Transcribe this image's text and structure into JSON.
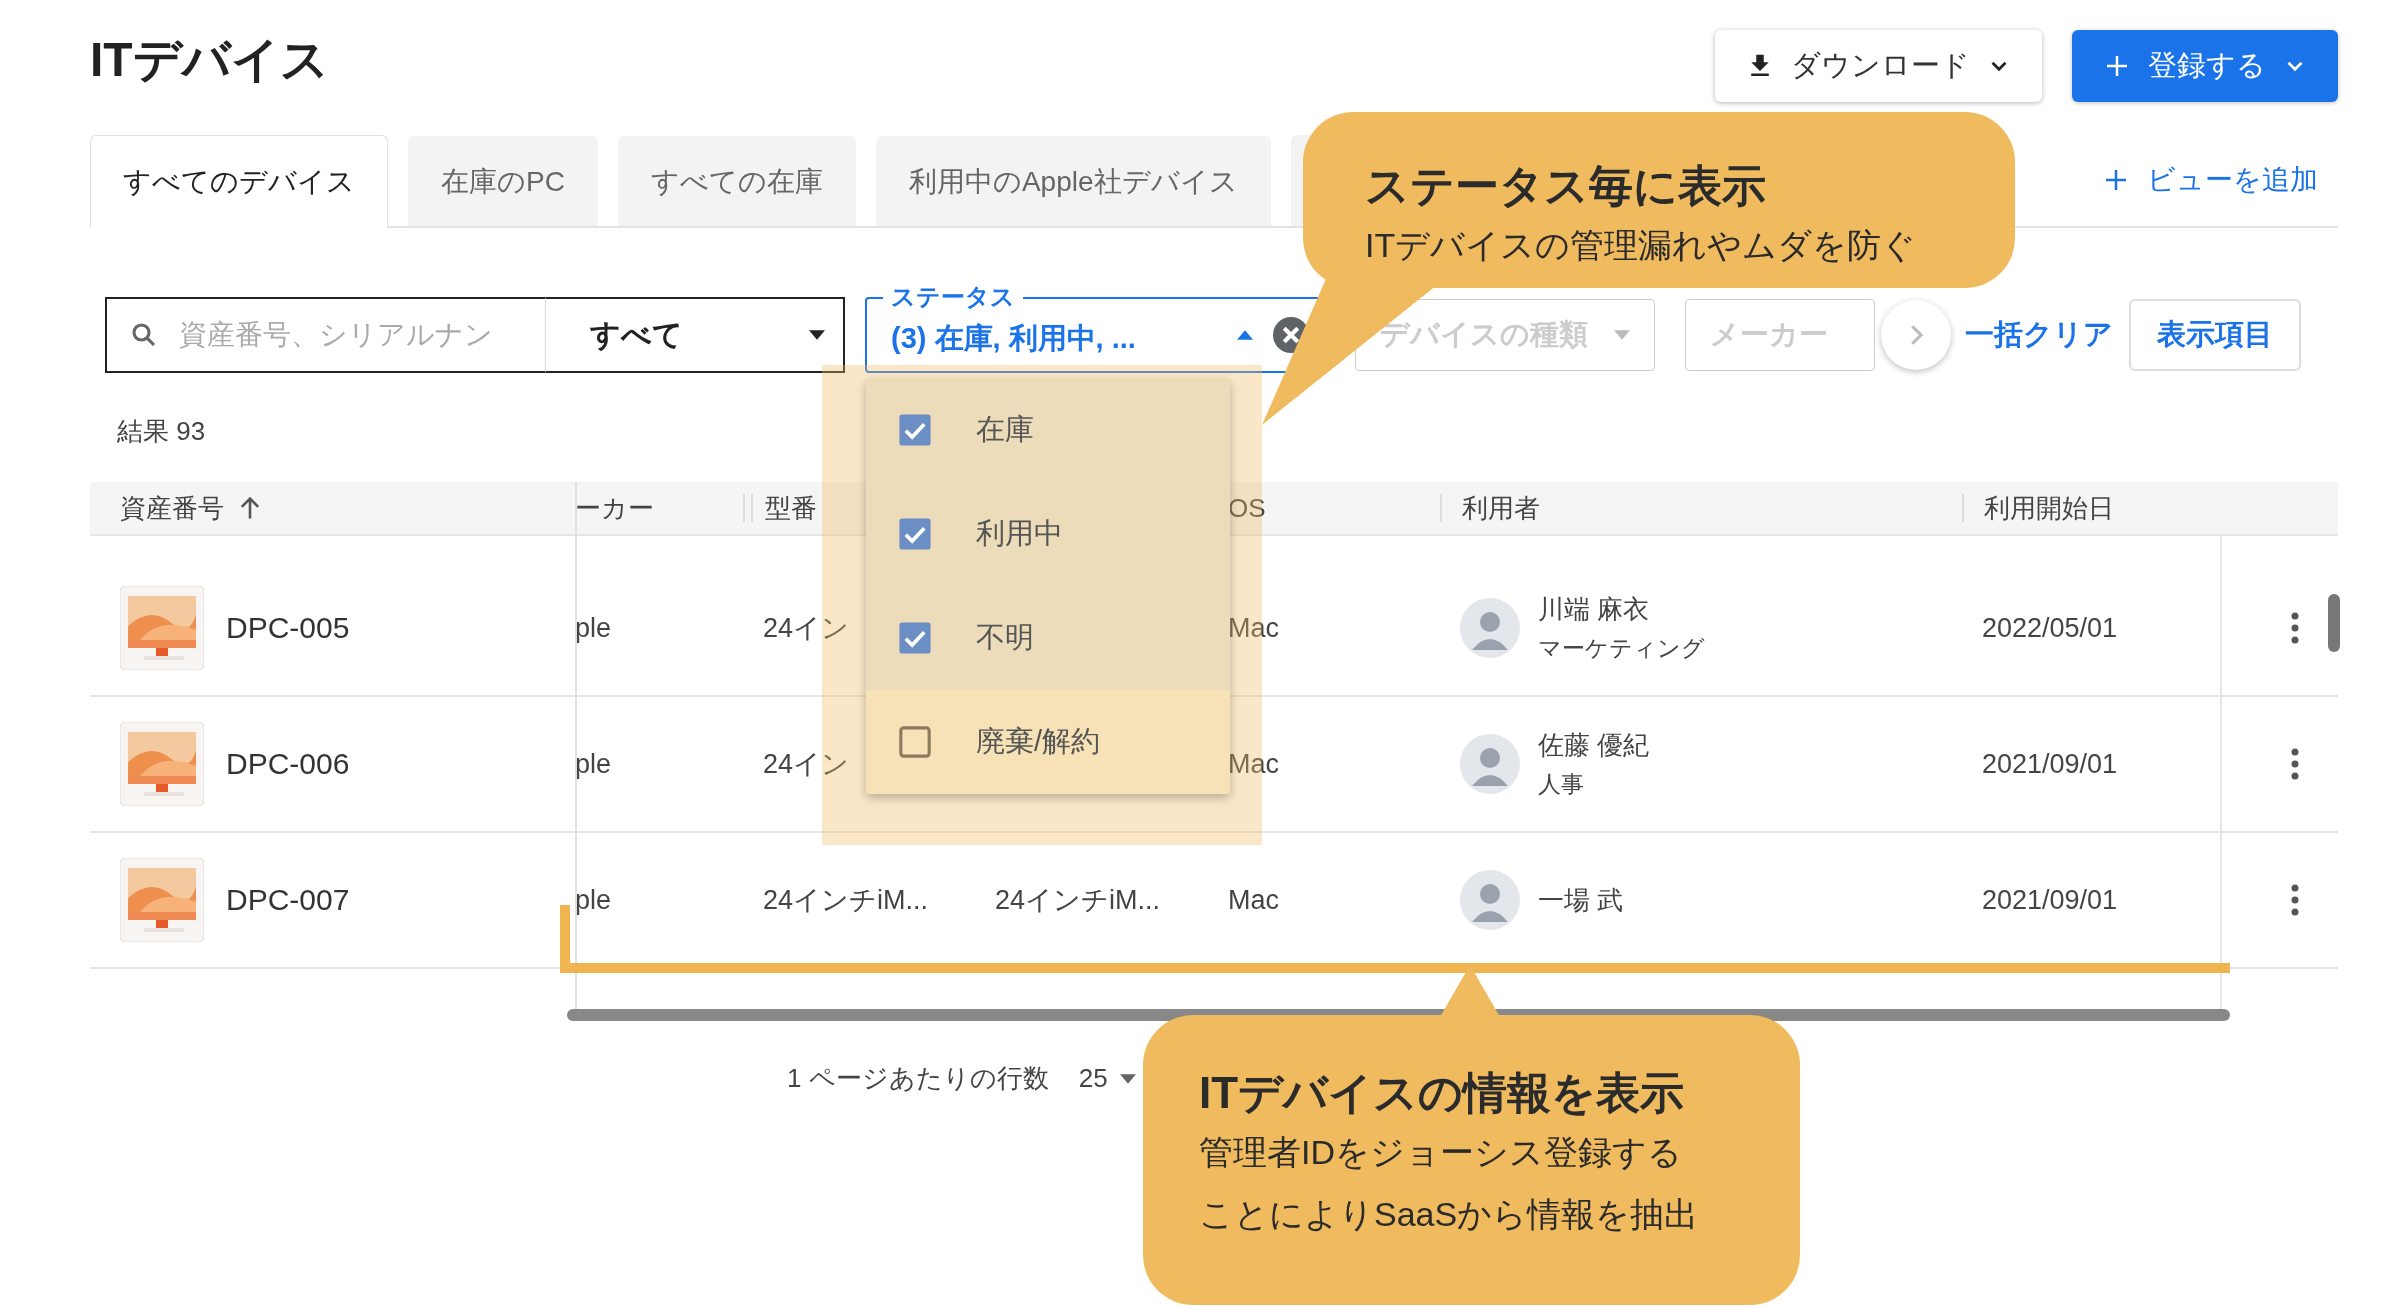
{
  "title": "ITデバイス",
  "actions": [
    {
      "label": "ダウンロード",
      "kind": "download"
    },
    {
      "label": "登録する",
      "kind": "register"
    }
  ],
  "tabs": [
    {
      "label": "すべてのデバイス",
      "selected": true
    },
    {
      "label": "在庫のPC",
      "selected": false
    },
    {
      "label": "すべての在庫",
      "selected": false
    },
    {
      "label": "利用中のApple社デバイス",
      "selected": false
    }
  ],
  "add_view": "ビューを追加",
  "filters": {
    "search": {
      "placeholder": "資産番号、シリアルナン"
    },
    "scope": "すべて",
    "status": {
      "label": "ステータス",
      "value": "(3) 在庫, 利用中, ...",
      "expanded": true,
      "options": [
        {
          "label": "在庫",
          "checked": true
        },
        {
          "label": "利用中",
          "checked": true
        },
        {
          "label": "不明",
          "checked": true
        },
        {
          "label": "廃棄/解約",
          "checked": false
        }
      ]
    },
    "device_type": "デバイスの種類",
    "maker": "メーカー",
    "clear_all": "一括クリア",
    "columns_button": "表示項目"
  },
  "result_count": "結果 93",
  "table": {
    "columns": [
      {
        "label": "資産番号",
        "sorted": true
      },
      {
        "label": "ーカー",
        "sorted": false
      },
      {
        "label": "型番",
        "sorted": false
      },
      {
        "label": "OS",
        "sorted": false
      },
      {
        "label": "利用者",
        "sorted": false
      },
      {
        "label": "利用開始日",
        "sorted": false
      }
    ],
    "rows": [
      {
        "asset_no": "DPC-005",
        "maker": "ple",
        "model": "24イン",
        "os": "Mac",
        "user": "川端 麻衣",
        "department": "マーケティング",
        "start_date": "2022/05/01"
      },
      {
        "asset_no": "DPC-006",
        "maker": "ple",
        "model": "24イン",
        "os": "Mac",
        "user": "佐藤 優紀",
        "department": "人事",
        "start_date": "2021/09/01"
      },
      {
        "asset_no": "DPC-007",
        "maker": "ple",
        "model": "24インチiM...",
        "model_2": "24インチiM...",
        "os": "Mac",
        "user": "一場 武",
        "start_date": "2021/09/01"
      }
    ]
  },
  "pagination": {
    "rows_per_page_label": "1 ページあたりの行数",
    "rows_per_page": "25"
  },
  "callouts": [
    {
      "title": "ステータス毎に表示",
      "lines": [
        "ITデバイスの管理漏れやムダを防ぐ"
      ]
    },
    {
      "title": "ITデバイスの情報を表示",
      "lines": [
        "管理者IDをジョーシス登録する",
        "ことによりSaaSから情報を抽出"
      ]
    }
  ]
}
